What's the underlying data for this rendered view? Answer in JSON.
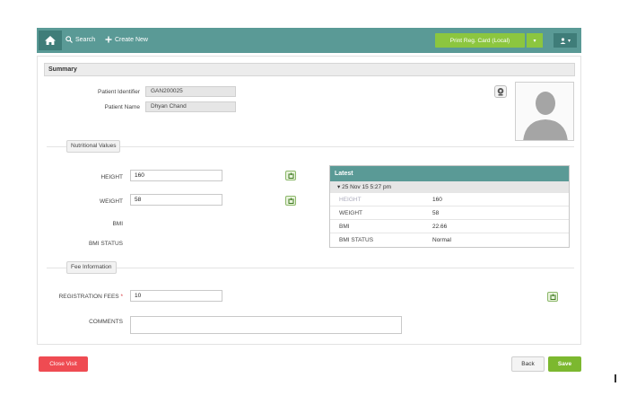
{
  "header": {
    "search_label": "Search",
    "create_label": "Create New",
    "print_label": "Print Reg. Card (Local)",
    "print_caret": "▾",
    "user_caret": "▾"
  },
  "summary": {
    "title": "Summary",
    "patient_identifier_label": "Patient Identifier",
    "patient_identifier_value": "GAN200025",
    "patient_name_label": "Patient Name",
    "patient_name_value": "Dhyan Chand"
  },
  "nutritional": {
    "section_label": "Nutritional Values",
    "height_label": "HEIGHT",
    "height_value": "160",
    "weight_label": "WEIGHT",
    "weight_value": "58",
    "bmi_label": "BMI",
    "bmi_status_label": "BMI STATUS"
  },
  "latest": {
    "title": "Latest",
    "date": "25 Nov 15 5:27 pm",
    "rows": [
      {
        "key": "HEIGHT",
        "value": "160"
      },
      {
        "key": "WEIGHT",
        "value": "58"
      },
      {
        "key": "BMI",
        "value": "22.66"
      },
      {
        "key": "BMI STATUS",
        "value": "Normal"
      }
    ]
  },
  "fee": {
    "section_label": "Fee Information",
    "registration_label": "REGISTRATION FEES",
    "required_mark": "*",
    "registration_value": "10",
    "comments_label": "COMMENTS",
    "comments_value": ""
  },
  "footer": {
    "close_label": "Close Visit",
    "back_label": "Back",
    "save_label": "Save"
  },
  "colors": {
    "teal": "#5a9a96",
    "green": "#8cc63f",
    "red": "#ef4b52"
  },
  "icons": [
    "home-icon",
    "search-icon",
    "plus-icon",
    "user-icon",
    "camera-icon",
    "edit-icon",
    "avatar-placeholder-icon"
  ]
}
